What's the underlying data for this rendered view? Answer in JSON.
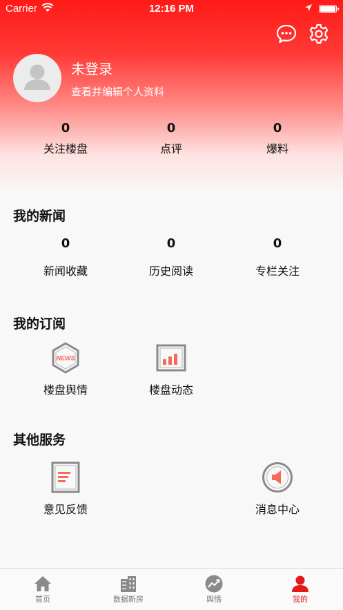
{
  "status_bar": {
    "carrier": "Carrier",
    "time": "12:16 PM"
  },
  "profile": {
    "name": "未登录",
    "edit_link": "查看并编辑个人资料"
  },
  "stats": [
    {
      "value": "0",
      "label": "关注楼盘"
    },
    {
      "value": "0",
      "label": "点评"
    },
    {
      "value": "0",
      "label": "爆料"
    }
  ],
  "my_news": {
    "title": "我的新闻",
    "items": [
      {
        "value": "0",
        "label": "新闻收藏"
      },
      {
        "value": "0",
        "label": "历史阅读"
      },
      {
        "value": "0",
        "label": "专栏关注"
      }
    ]
  },
  "my_subscriptions": {
    "title": "我的订阅",
    "items": [
      {
        "label": "楼盘舆情",
        "icon": "news-hexagon-icon",
        "badge": "NEWS"
      },
      {
        "label": "楼盘动态",
        "icon": "bar-chart-icon"
      }
    ]
  },
  "other_services": {
    "title": "其他服务",
    "items": [
      {
        "label": "意见反馈",
        "icon": "document-icon"
      },
      {
        "label": "消息中心",
        "icon": "speaker-icon"
      }
    ]
  },
  "tabbar": {
    "items": [
      {
        "label": "首页",
        "icon": "home-icon",
        "active": false
      },
      {
        "label": "数据新房",
        "icon": "building-icon",
        "active": false
      },
      {
        "label": "舆情",
        "icon": "trend-icon",
        "active": false
      },
      {
        "label": "我的",
        "icon": "user-icon",
        "active": true
      }
    ]
  },
  "colors": {
    "accent": "#e21a1a",
    "icon_red": "#f26b5b",
    "icon_gray": "#888888"
  }
}
